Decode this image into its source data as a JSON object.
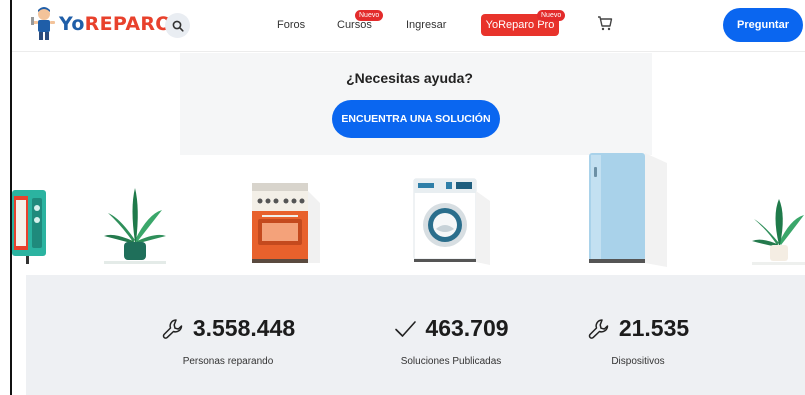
{
  "header": {
    "logo_yo": "Yo",
    "logo_reparo": "REPARO",
    "nav": {
      "foros": "Foros",
      "cursos": "Cursos",
      "ingresar": "Ingresar",
      "yoreparo_pro": "YoReparo Pro"
    },
    "badge_new": "Nuevo",
    "ask_button": "Preguntar"
  },
  "hero": {
    "title": "¿Necesitas ayuda?",
    "cta": "ENCUENTRA UNA SOLUCIÓN",
    "illustrations": [
      "microwave-icon",
      "plant-icon",
      "stove-icon",
      "washing-machine-icon",
      "refrigerator-icon",
      "plant-icon"
    ]
  },
  "stats": [
    {
      "icon": "wrench-icon",
      "value": "3.558.448",
      "label": "Personas reparando"
    },
    {
      "icon": "checkmark-icon",
      "value": "463.709",
      "label": "Soluciones Publicadas"
    },
    {
      "icon": "wrench-icon",
      "value": "21.535",
      "label": "Dispositivos"
    }
  ],
  "colors": {
    "primary": "#0a66f0",
    "brand_red": "#e8412c",
    "brand_blue": "#1f5ea8",
    "stats_bg": "#eef0f3"
  }
}
